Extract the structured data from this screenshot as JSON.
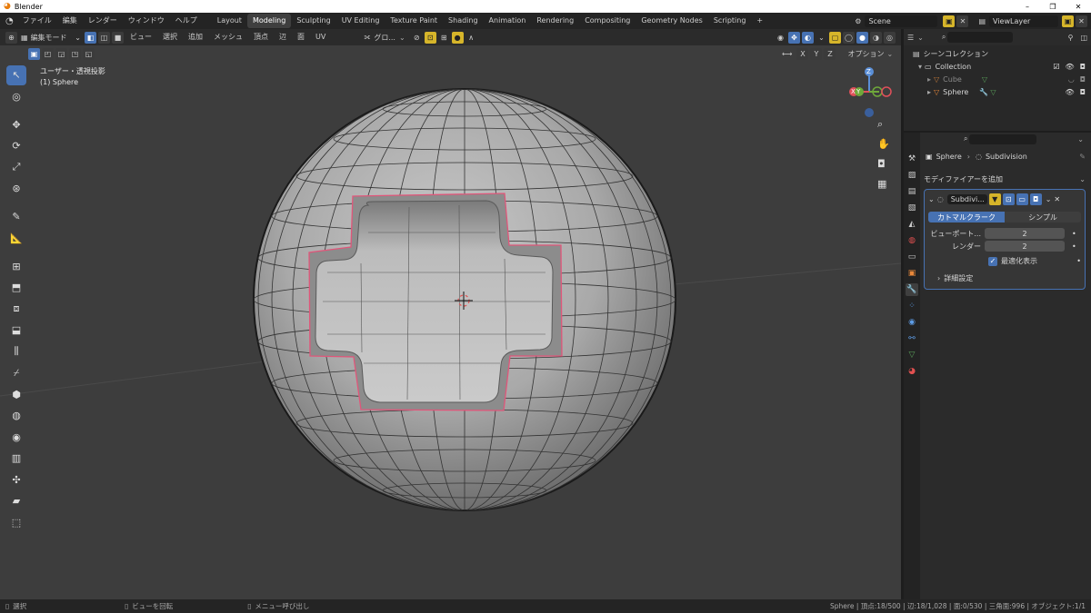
{
  "window": {
    "title": "Blender"
  },
  "menu": [
    "ファイル",
    "編集",
    "レンダー",
    "ウィンドウ",
    "ヘルプ"
  ],
  "workspaces": {
    "tabs": [
      "Layout",
      "Modeling",
      "Sculpting",
      "UV Editing",
      "Texture Paint",
      "Shading",
      "Animation",
      "Rendering",
      "Compositing",
      "Geometry Nodes",
      "Scripting"
    ],
    "active": "Modeling",
    "add": "+"
  },
  "scene": {
    "name": "Scene",
    "view_layer": "ViewLayer"
  },
  "header": {
    "mode": "編集モード",
    "menus": [
      "ビュー",
      "選択",
      "追加",
      "メッシュ",
      "頂点",
      "辺",
      "面",
      "UV"
    ],
    "transform_orientation": "グロ...",
    "axes": [
      "X",
      "Y",
      "Z"
    ],
    "options": "オプション"
  },
  "viewport": {
    "view_name": "ユーザー・透視投影",
    "object_name": "(1) Sphere",
    "gizmo": {
      "z": "Z",
      "y": "Y",
      "x": "X"
    }
  },
  "outliner": {
    "title": "シーンコレクション",
    "items": [
      {
        "label": "Collection"
      },
      {
        "label": "Cube"
      },
      {
        "label": "Sphere"
      }
    ]
  },
  "properties": {
    "breadcrumb_object": "Sphere",
    "breadcrumb_modifier": "Subdivision",
    "add_modifier": "モディファイアーを追加",
    "modifier_name": "Subdivi...",
    "type_catmull": "カトマルクラーク",
    "type_simple": "シンプル",
    "viewport_label": "ビューポート...",
    "viewport_value": "2",
    "render_label": "レンダー",
    "render_value": "2",
    "optimal_display": "最適化表示",
    "advanced": "詳細設定"
  },
  "status": {
    "select": "選択",
    "rotate_view": "ビューを回転",
    "call_menu": "メニュー呼び出し",
    "stats": "Sphere | 頂点:18/500 | 辺:18/1,028 | 面:0/530 | 三角面:996 | オブジェクト:1/1"
  },
  "colors": {
    "accent": "#4772b3",
    "selection": "#e0567a",
    "viewport_bg": "#3d3d3d"
  }
}
